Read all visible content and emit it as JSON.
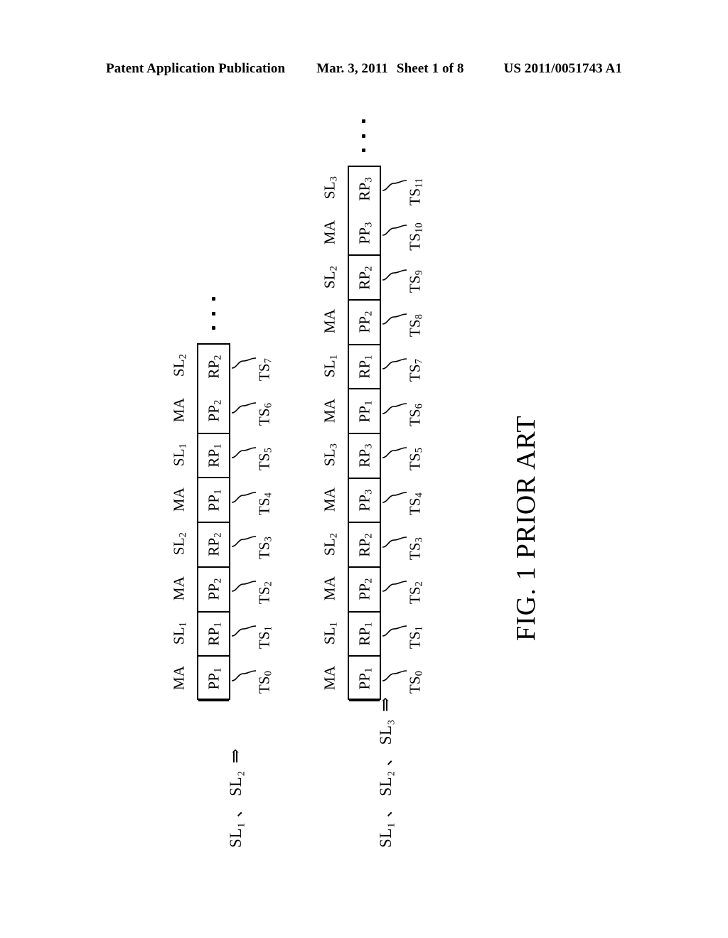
{
  "header": {
    "publication": "Patent Application Publication",
    "date": "Mar. 3, 2011",
    "sheet": "Sheet 1 of 8",
    "number": "US 2011/0051743 A1"
  },
  "figure": {
    "caption": "FIG. 1 PRIOR ART"
  },
  "diagrams": [
    {
      "id": "diagram-two-slaves",
      "side_label": "SL₁ 、 SL₂",
      "side_arrow": "⇒",
      "ellipsis": "⋮",
      "cells": [
        {
          "packet": "PP₁",
          "role": "MA",
          "timeslot": "TS₀"
        },
        {
          "packet": "RP₁",
          "role": "SL₁",
          "timeslot": "TS₁"
        },
        {
          "packet": "PP₂",
          "role": "MA",
          "timeslot": "TS₂"
        },
        {
          "packet": "RP₂",
          "role": "SL₂",
          "timeslot": "TS₃"
        },
        {
          "packet": "PP₁",
          "role": "MA",
          "timeslot": "TS₄"
        },
        {
          "packet": "RP₁",
          "role": "SL₁",
          "timeslot": "TS₅"
        },
        {
          "packet": "PP₂",
          "role": "MA",
          "timeslot": "TS₆"
        },
        {
          "packet": "RP₂",
          "role": "SL₂",
          "timeslot": "TS₇"
        }
      ]
    },
    {
      "id": "diagram-three-slaves",
      "side_label": "SL₁ 、 SL₂ 、 SL₃",
      "side_arrow": "⇒",
      "ellipsis": "⋮",
      "cells": [
        {
          "packet": "PP₁",
          "role": "MA",
          "timeslot": "TS₀"
        },
        {
          "packet": "RP₁",
          "role": "SL₁",
          "timeslot": "TS₁"
        },
        {
          "packet": "PP₂",
          "role": "MA",
          "timeslot": "TS₂"
        },
        {
          "packet": "RP₂",
          "role": "SL₂",
          "timeslot": "TS₃"
        },
        {
          "packet": "PP₃",
          "role": "MA",
          "timeslot": "TS₄"
        },
        {
          "packet": "RP₃",
          "role": "SL₃",
          "timeslot": "TS₅"
        },
        {
          "packet": "PP₁",
          "role": "MA",
          "timeslot": "TS₆"
        },
        {
          "packet": "RP₁",
          "role": "SL₁",
          "timeslot": "TS₇"
        },
        {
          "packet": "PP₂",
          "role": "MA",
          "timeslot": "TS₈"
        },
        {
          "packet": "RP₂",
          "role": "SL₂",
          "timeslot": "TS₉"
        },
        {
          "packet": "PP₃",
          "role": "MA",
          "timeslot": "TS₁₀"
        },
        {
          "packet": "RP₃",
          "role": "SL₃",
          "timeslot": "TS₁₁"
        }
      ]
    }
  ]
}
